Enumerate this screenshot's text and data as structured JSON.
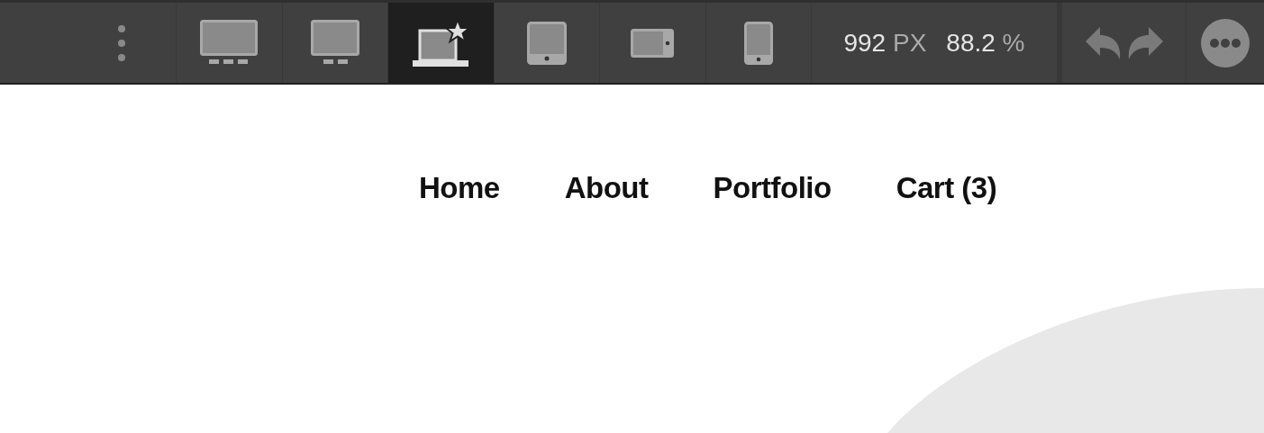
{
  "toolbar": {
    "devices": [
      {
        "kind": "desktop-wide",
        "selected": false
      },
      {
        "kind": "desktop",
        "selected": false
      },
      {
        "kind": "laptop",
        "selected": true
      },
      {
        "kind": "tablet",
        "selected": false
      },
      {
        "kind": "tablet-landscape",
        "selected": false
      },
      {
        "kind": "phone",
        "selected": false
      }
    ],
    "width_value": "992",
    "width_unit": "PX",
    "zoom_value": "88.2",
    "zoom_unit": "%"
  },
  "nav": [
    {
      "label": "Home"
    },
    {
      "label": "About"
    },
    {
      "label": "Portfolio"
    },
    {
      "label": "Cart (3)"
    }
  ]
}
